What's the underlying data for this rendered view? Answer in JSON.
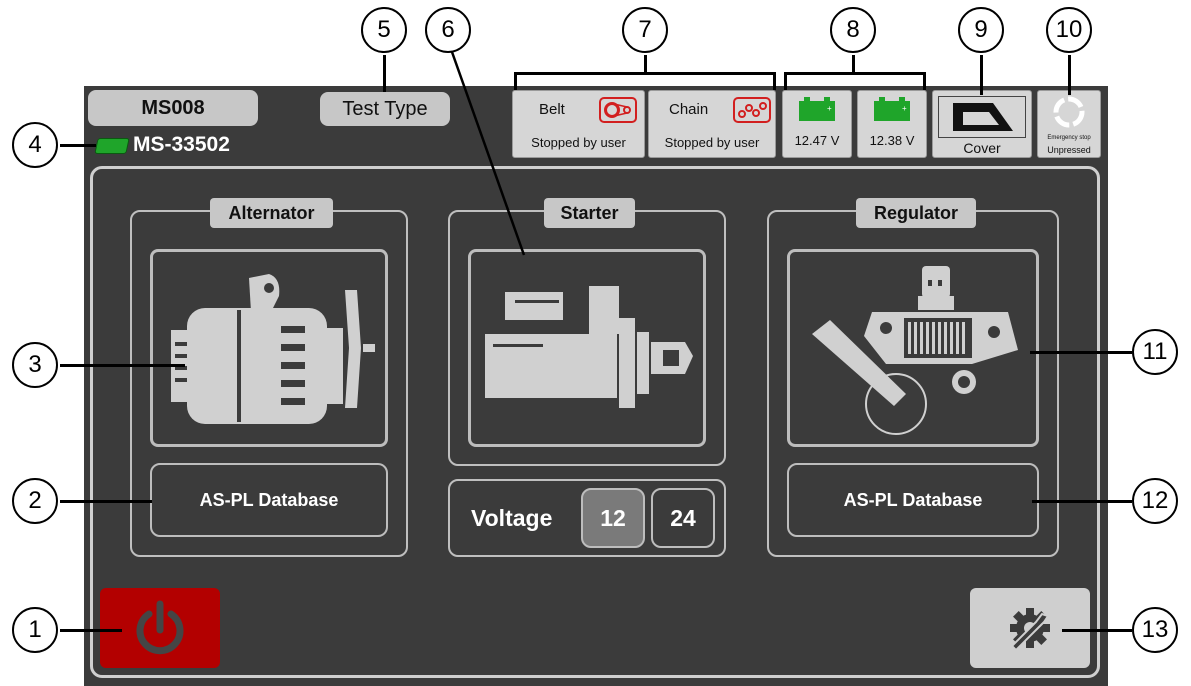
{
  "header": {
    "station_id": "MS008",
    "device_id": "MS-33502",
    "test_type": "Test Type"
  },
  "status": {
    "belt": {
      "label": "Belt",
      "status": "Stopped by user"
    },
    "chain": {
      "label": "Chain",
      "status": "Stopped by user"
    },
    "battery1": "12.47 V",
    "battery2": "12.38 V",
    "cover": "Cover",
    "estop_title": "Emergency stop",
    "estop_status": "Unpressed"
  },
  "sections": {
    "alternator": {
      "label": "Alternator",
      "db_button": "AS-PL Database"
    },
    "starter": {
      "label": "Starter"
    },
    "regulator": {
      "label": "Regulator",
      "db_button": "AS-PL Database"
    }
  },
  "voltage": {
    "label": "Voltage",
    "options": [
      "12",
      "24"
    ],
    "selected": "12"
  },
  "callouts": [
    "1",
    "2",
    "3",
    "4",
    "5",
    "6",
    "7",
    "8",
    "9",
    "10",
    "11",
    "12",
    "13"
  ],
  "colors": {
    "background": "#3b3b3b",
    "power": "#b30000",
    "battery": "#1fa52a",
    "accent_red": "#d21f1f"
  },
  "icons": [
    "power-icon",
    "settings-icon",
    "alternator-image",
    "starter-image",
    "regulator-image",
    "battery-icon",
    "belt-icon",
    "chain-icon",
    "cover-icon",
    "emergency-stop-icon"
  ]
}
